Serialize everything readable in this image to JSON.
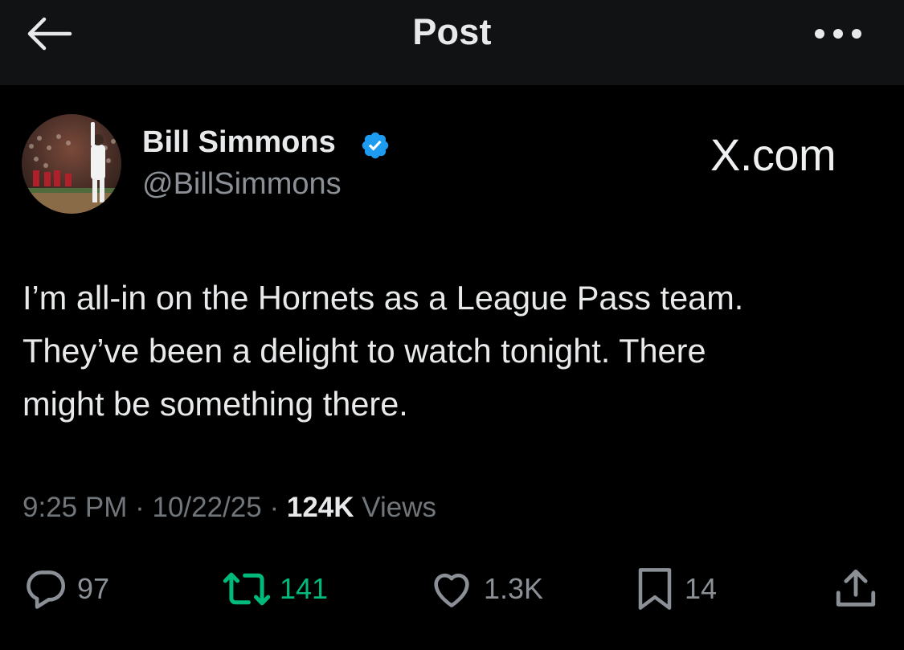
{
  "header": {
    "title": "Post"
  },
  "author": {
    "display_name": "Bill Simmons",
    "handle": "@BillSimmons",
    "verified": true
  },
  "watermark": "X.com",
  "tweet": {
    "lines": [
      "I’m all-in on the Hornets as a League Pass team.",
      "They’ve been a delight to watch tonight. There",
      "might be something there."
    ]
  },
  "meta": {
    "time": "9:25 PM",
    "separator": "·",
    "date": "10/22/25",
    "views_count": "124K",
    "views_label": "Views"
  },
  "actions": {
    "reply_count": "97",
    "retweet_count": "141",
    "like_count": "1.3K",
    "bookmark_count": "14"
  },
  "icons": {
    "back": "arrow-left-icon",
    "more": "more-dots-icon",
    "verified": "verified-badge-icon",
    "reply": "reply-bubble-icon",
    "retweet": "retweet-icon",
    "like": "heart-icon",
    "bookmark": "bookmark-icon",
    "share": "share-upload-icon"
  },
  "colors": {
    "background": "#000000",
    "header_background": "#111214",
    "text_primary": "#e7e9ea",
    "text_secondary": "#71767b",
    "verified_blue": "#1d9bf0",
    "retweet_green": "#00ba7c"
  }
}
